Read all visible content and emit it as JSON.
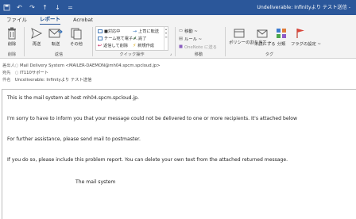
{
  "window": {
    "title": "Undeliverable: Infinityより テスト送信 -"
  },
  "ribbon": {
    "tabs": [
      "ファイル",
      "レポート",
      "Acrobat"
    ],
    "delete": {
      "label": "削除",
      "group": "削除"
    },
    "reply": {
      "label": "再送"
    },
    "forward": {
      "label": "転送"
    },
    "other": {
      "label": "その他"
    },
    "reply_group": "返信",
    "quick_steps": {
      "items": [
        "■対応中",
        "チーム宛て電子メ...",
        "返信して削除",
        "上司に転送",
        "完了",
        "新規作成"
      ],
      "group": "クイック操作"
    },
    "move": {
      "items": [
        "移動 ~",
        "ルール ~",
        "OneNote に送る"
      ],
      "group": "移動"
    },
    "tags": {
      "policy": "ポリシーの割り当て ~",
      "unread": "未読にする",
      "categorize": "分類",
      "flag": "フラグの設定 ~",
      "group": "タグ"
    }
  },
  "headers": {
    "from_label": "差出人",
    "from_value": "Mail Delivery System <MAILER-DAEMON@mh04.spcm.spcloud.jp>",
    "to_label": "宛先",
    "to_value": "IT110サポート",
    "subject_label": "件名",
    "subject_value": "Unceliverable: Infinityより テスト送信"
  },
  "body": {
    "paragraphs": [
      "This is the mail system at host mh04.spcm.spcloud.jp.",
      "I'm sorry to have to inform you that your message could not be delivered to one or more recipients. It's attached below",
      "For further assistance, please send mail to postmaster.",
      "If you do so, please include this problem report. You can delete your own text from the attached returned message.",
      "The mail system"
    ]
  },
  "colors": {
    "titlebar": "#2b579a",
    "ribbon": "#f3f3f3",
    "accent": "#1b4d8f"
  }
}
